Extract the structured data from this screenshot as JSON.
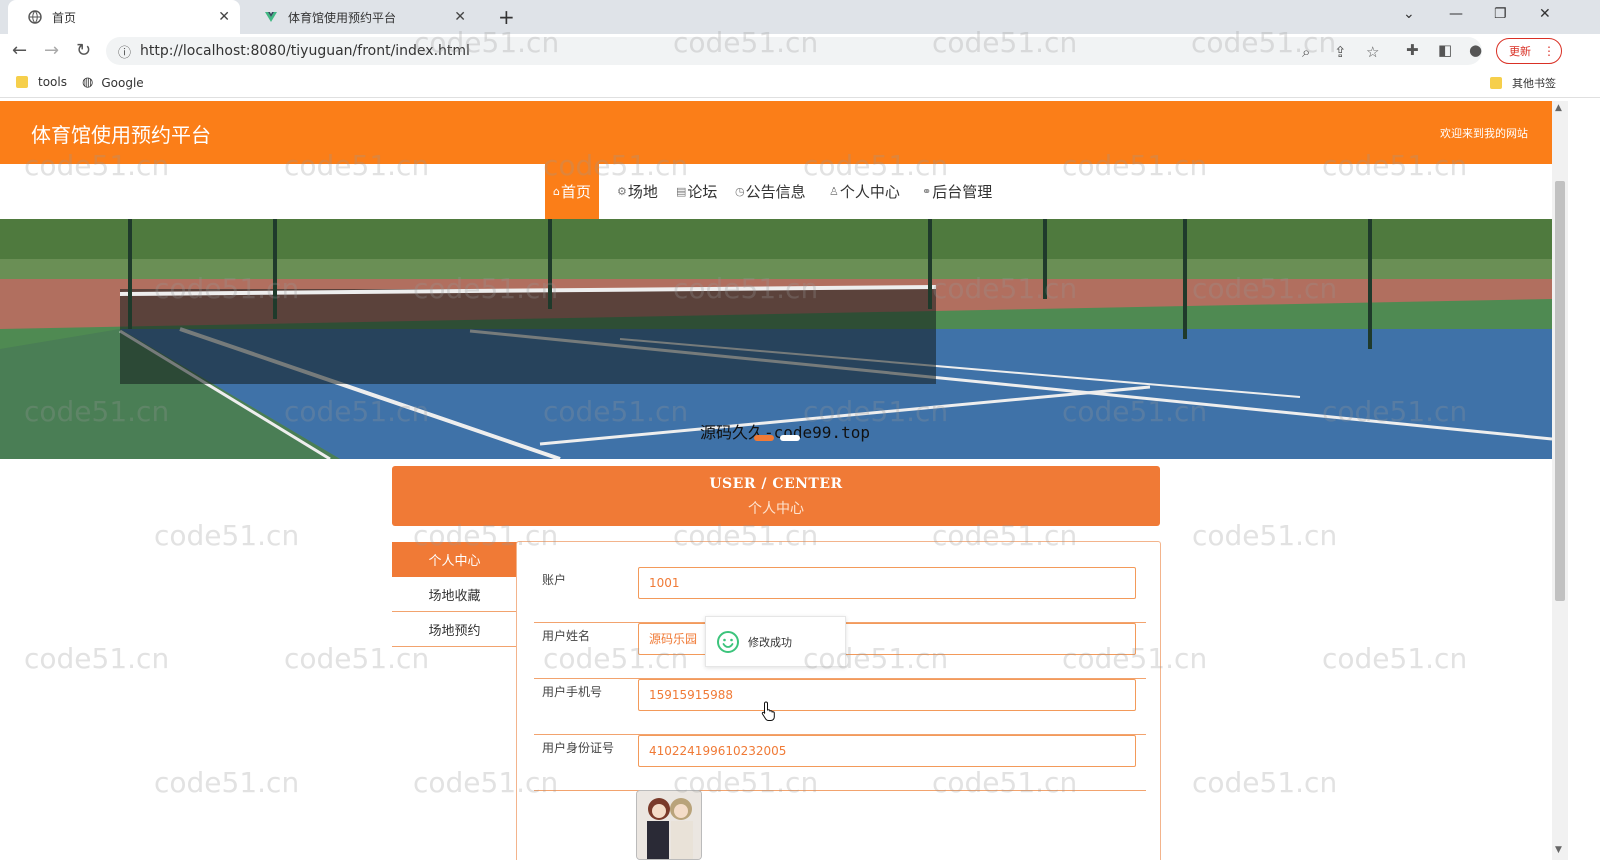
{
  "browser": {
    "tabs": [
      {
        "title": "首页",
        "active": true
      },
      {
        "title": "体育馆使用预约平台",
        "active": false
      }
    ],
    "url": "http://localhost:8080/tiyuguan/front/index.html",
    "update_label": "更新",
    "bookmarks": [
      "tools",
      "Google"
    ],
    "other_bookmarks": "其他书签"
  },
  "header": {
    "site_title": "体育馆使用预约平台",
    "welcome": "欢迎来到我的网站"
  },
  "nav": {
    "items": [
      {
        "label": "首页",
        "icon": "home-icon"
      },
      {
        "label": "场地",
        "icon": "gear-icon"
      },
      {
        "label": "论坛",
        "icon": "document-icon"
      },
      {
        "label": "公告信息",
        "icon": "clock-icon"
      },
      {
        "label": "个人中心",
        "icon": "user-icon"
      },
      {
        "label": "后台管理",
        "icon": "link-icon"
      }
    ],
    "active_index": 0
  },
  "banner": {
    "caption": "源码久久-code99.top",
    "carousel_active_dot": 0
  },
  "user_center": {
    "title_en": "USER / CENTER",
    "title_cn": "个人中心"
  },
  "side_menu": {
    "items": [
      "个人中心",
      "场地收藏",
      "场地预约"
    ],
    "active_index": 0
  },
  "form": {
    "fields": [
      {
        "label": "账户",
        "value": "1001"
      },
      {
        "label": "用户姓名",
        "value": "源码乐园"
      },
      {
        "label": "用户手机号",
        "value": "15915915988"
      },
      {
        "label": "用户身份证号",
        "value": "410224199610232005"
      }
    ]
  },
  "toast": {
    "message": "修改成功",
    "icon": "smile-icon"
  },
  "watermark": "code51.cn",
  "colors": {
    "accent": "#fb7e18",
    "accent_dark": "#f07a36"
  }
}
